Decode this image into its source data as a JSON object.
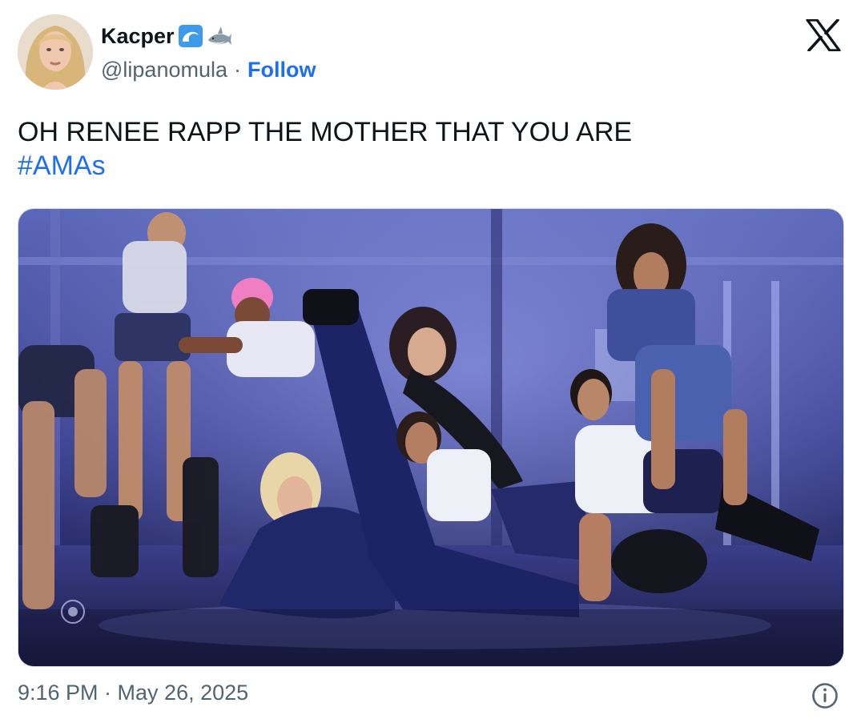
{
  "author": {
    "display_name": "Kacper",
    "handle": "@lipanomula",
    "separator": "·",
    "follow_label": "Follow",
    "emojis": [
      "wave-emoji",
      "shark-emoji"
    ]
  },
  "tweet": {
    "text": "OH RENEE RAPP THE MOTHER THAT YOU ARE",
    "hashtag": "#AMAs"
  },
  "media": {
    "type": "photo",
    "description_icon": "stage-performance-photo"
  },
  "meta": {
    "timestamp": "9:16 PM · May 26, 2025"
  },
  "colors": {
    "link": "#1d6ff2",
    "secondary_text": "#536471",
    "primary_text": "#0f1419",
    "border": "#cfd9de"
  },
  "icons": {
    "brand": "x-logo-icon",
    "info": "info-icon"
  }
}
